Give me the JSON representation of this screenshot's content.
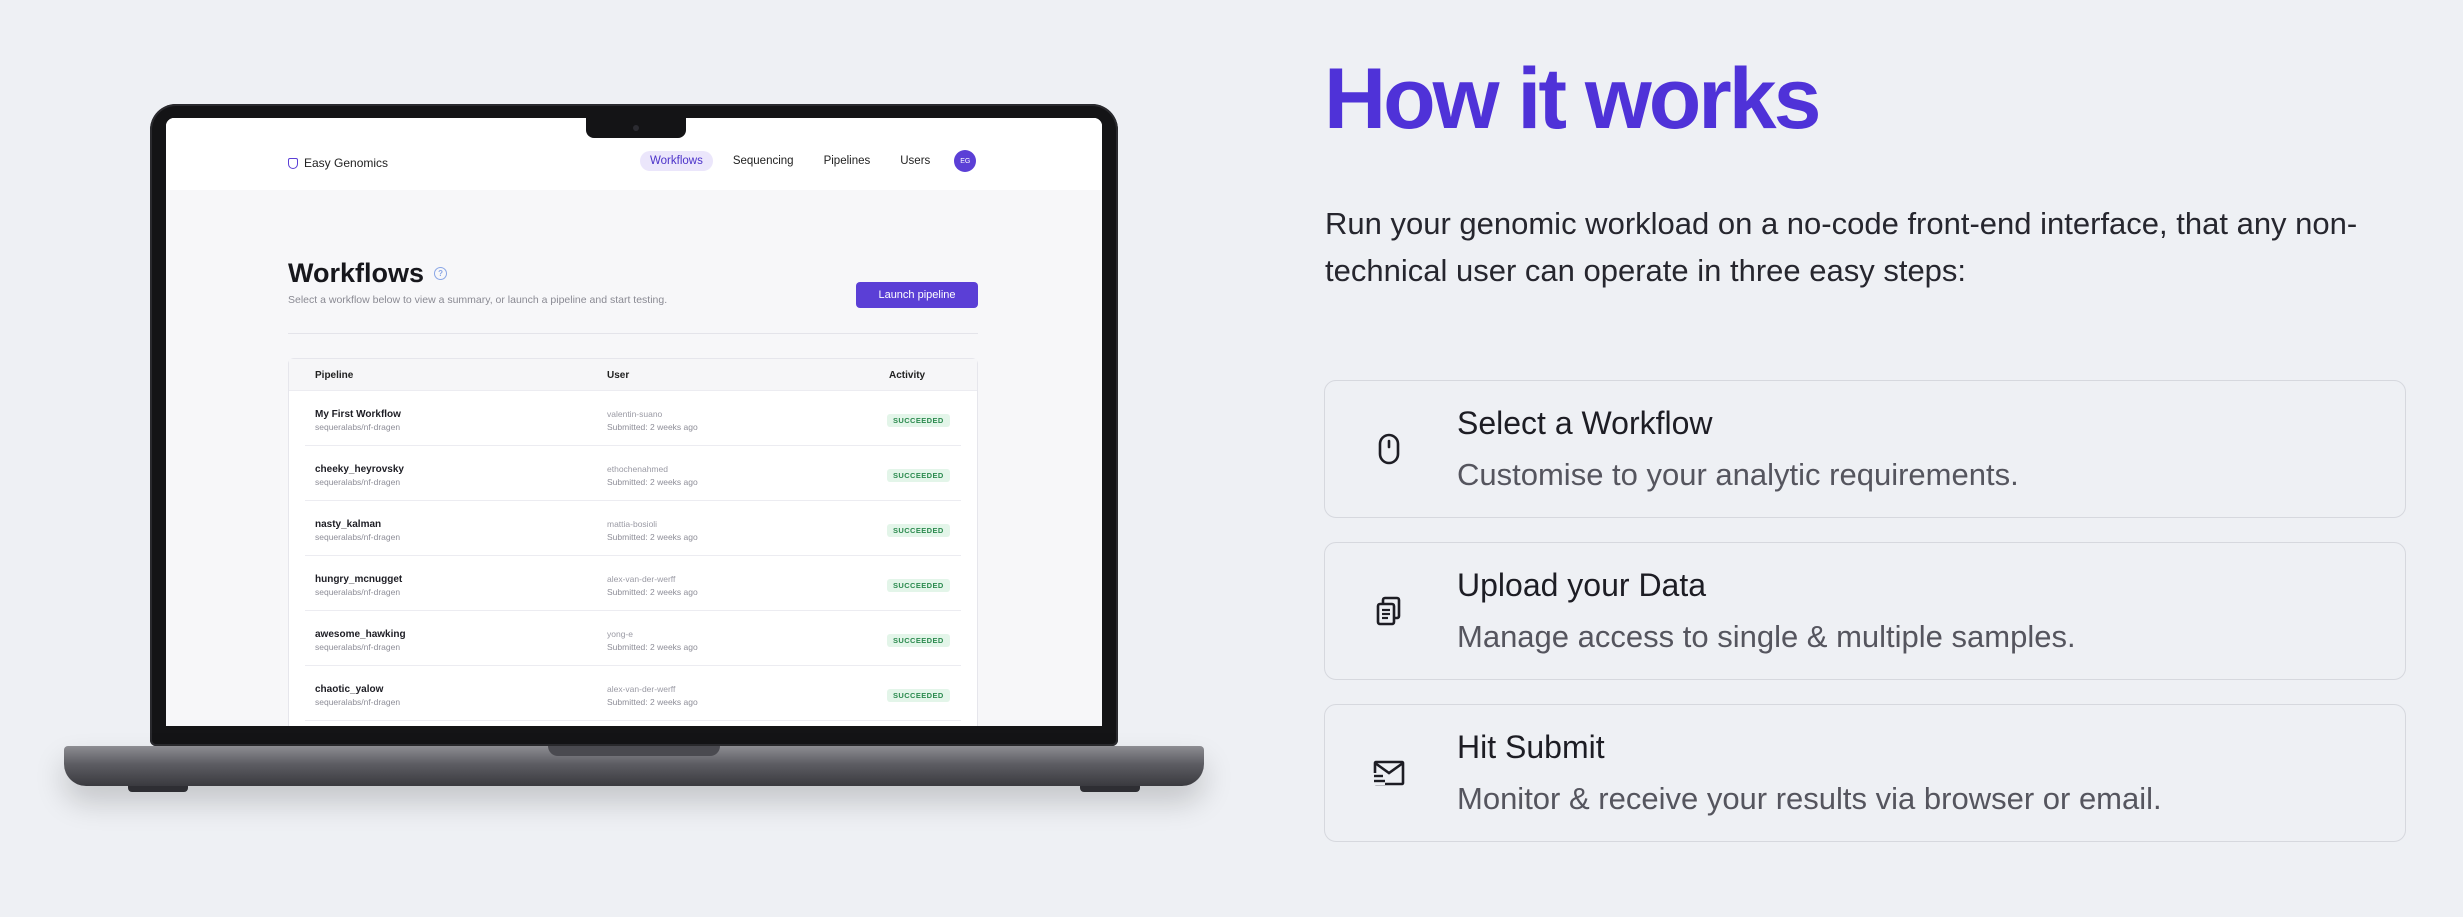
{
  "laptop_app": {
    "brand": "Easy Genomics",
    "nav": [
      {
        "label": "Workflows",
        "active": true
      },
      {
        "label": "Sequencing",
        "active": false
      },
      {
        "label": "Pipelines",
        "active": false
      },
      {
        "label": "Users",
        "active": false
      }
    ],
    "avatar": "EG",
    "title": "Workflows",
    "subtitle": "Select a workflow below to view a summary, or launch a pipeline and start testing.",
    "launch_label": "Launch pipeline",
    "columns": [
      "Pipeline",
      "User",
      "Activity"
    ],
    "rows": [
      {
        "name": "My First Workflow",
        "pipeline": "sequeralabs/nf-dragen",
        "user": "valentin-suano",
        "submitted": "Submitted: 2 weeks ago",
        "status": "SUCCEEDED"
      },
      {
        "name": "cheeky_heyrovsky",
        "pipeline": "sequeralabs/nf-dragen",
        "user": "ethochenahmed",
        "submitted": "Submitted: 2 weeks ago",
        "status": "SUCCEEDED"
      },
      {
        "name": "nasty_kalman",
        "pipeline": "sequeralabs/nf-dragen",
        "user": "mattia-bosioli",
        "submitted": "Submitted: 2 weeks ago",
        "status": "SUCCEEDED"
      },
      {
        "name": "hungry_mcnugget",
        "pipeline": "sequeralabs/nf-dragen",
        "user": "alex-van-der-werff",
        "submitted": "Submitted: 2 weeks ago",
        "status": "SUCCEEDED"
      },
      {
        "name": "awesome_hawking",
        "pipeline": "sequeralabs/nf-dragen",
        "user": "yong-e",
        "submitted": "Submitted: 2 weeks ago",
        "status": "SUCCEEDED"
      },
      {
        "name": "chaotic_yalow",
        "pipeline": "sequeralabs/nf-dragen",
        "user": "alex-van-der-werff",
        "submitted": "Submitted: 2 weeks ago",
        "status": "SUCCEEDED"
      }
    ]
  },
  "how_it_works": {
    "title": "How it works",
    "intro": "Run your genomic workload on a no-code front-end interface, that any non-technical user can operate in three easy steps:",
    "steps": [
      {
        "icon": "mouse-icon",
        "title": "Select a Workflow",
        "description": "Customise to your analytic requirements."
      },
      {
        "icon": "documents-icon",
        "title": "Upload your Data",
        "description": "Manage access to single & multiple samples."
      },
      {
        "icon": "send-mail-icon",
        "title": "Hit Submit",
        "description": "Monitor & receive your results via browser or email."
      }
    ]
  },
  "colors": {
    "accent": "#4f32d8",
    "background": "#eef0f4",
    "status_success": "#2b8a4e"
  }
}
